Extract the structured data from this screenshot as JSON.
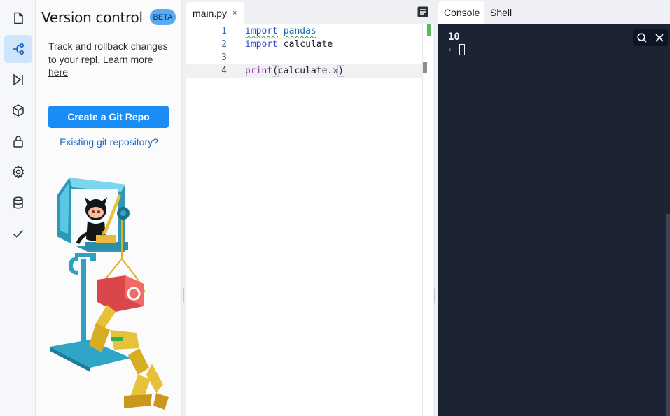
{
  "sidebar": {
    "icons": [
      "files-icon",
      "version-control-icon",
      "debugger-icon",
      "packages-icon",
      "secrets-icon",
      "settings-icon",
      "database-icon",
      "unit-tests-icon"
    ],
    "active": "version-control-icon"
  },
  "version_control": {
    "title": "Version control",
    "badge": "BETA",
    "description": "Track and rollback changes to your repl.",
    "learn_more": "Learn more here",
    "create_button": "Create a Git Repo",
    "existing_link": "Existing git repository?"
  },
  "editor": {
    "tab_name": "main.py",
    "tab_close": "×",
    "lines": [
      {
        "number": "1",
        "keyword": "import",
        "rest": "pandas"
      },
      {
        "number": "2",
        "keyword": "import",
        "rest": "calculate"
      },
      {
        "number": "3"
      },
      {
        "number": "4",
        "func": "print",
        "open": "(",
        "obj": "calculate.",
        "attr": "x",
        "close": ")"
      }
    ]
  },
  "console": {
    "tabs": [
      "Console",
      "Shell"
    ],
    "active_tab": "Console",
    "output": "10",
    "prompt": "›"
  },
  "colors": {
    "accent": "#1a8cf5",
    "console_bg": "#1c2333",
    "beta_badge": "#59abf5"
  }
}
